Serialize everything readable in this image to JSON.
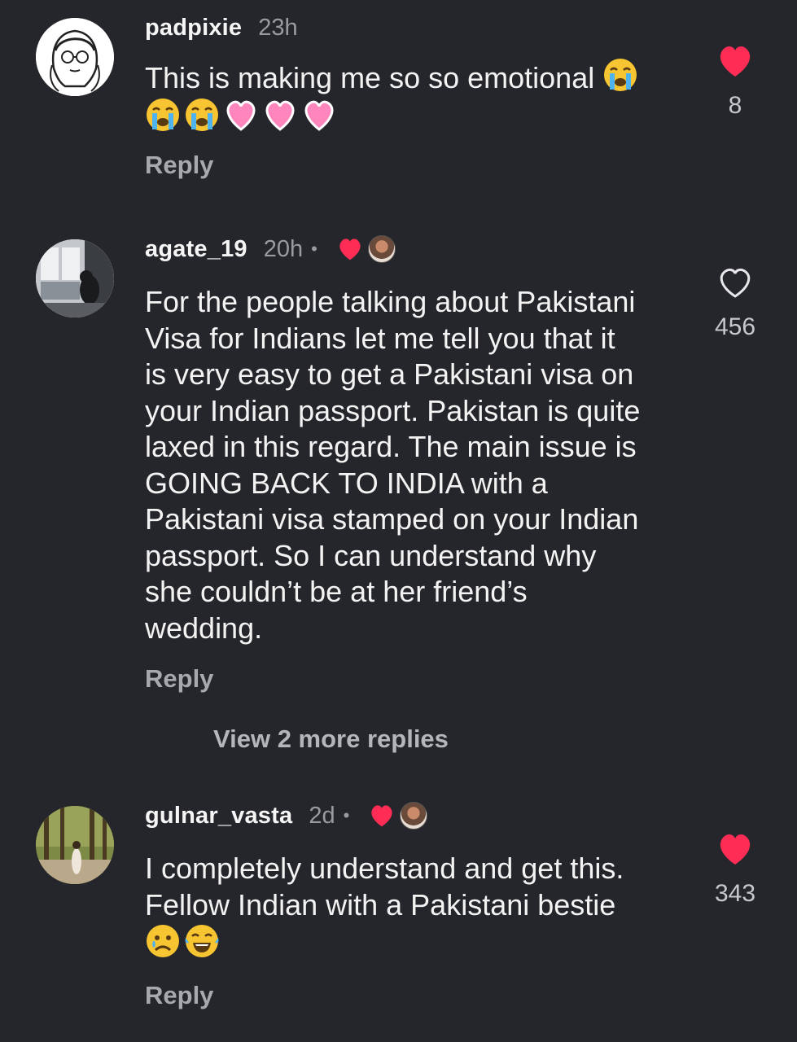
{
  "comments": [
    {
      "username": "padpixie",
      "time": "23h",
      "text": "This is making me so so emotional",
      "emojis_inline": [
        "crying-face"
      ],
      "emojis_line2": [
        "crying-face",
        "crying-face",
        "pink-heart",
        "pink-heart",
        "pink-heart"
      ],
      "reply_label": "Reply",
      "likes": "8",
      "liked": true
    },
    {
      "username": "agate_19",
      "time": "20h",
      "creator_liked": true,
      "text": "For the people talking about Pakistani\nVisa for Indians let me tell you that it\nis very easy to get a Pakistani visa on\nyour Indian passport. Pakistan is quite\nlaxed in this regard. The main issue is\nGOING BACK TO INDIA with a\nPakistani visa stamped on your Indian\npassport. So I can understand why\nshe couldn’t be at her friend’s\nwedding.",
      "reply_label": "Reply",
      "likes": "456",
      "liked": false,
      "more_replies": "View 2 more replies"
    },
    {
      "username": "gulnar_vasta",
      "time": "2d",
      "creator_liked": true,
      "text": "I completely understand and get this.\nFellow Indian with a Pakistani bestie",
      "emojis_line": [
        "sad-tear-face",
        "laughing-tears-face"
      ],
      "reply_label": "Reply",
      "likes": "343",
      "liked": true
    }
  ],
  "colors": {
    "background": "#25262b",
    "like_red": "#ff2d55",
    "muted": "#9a9ba0"
  },
  "dot": "•"
}
